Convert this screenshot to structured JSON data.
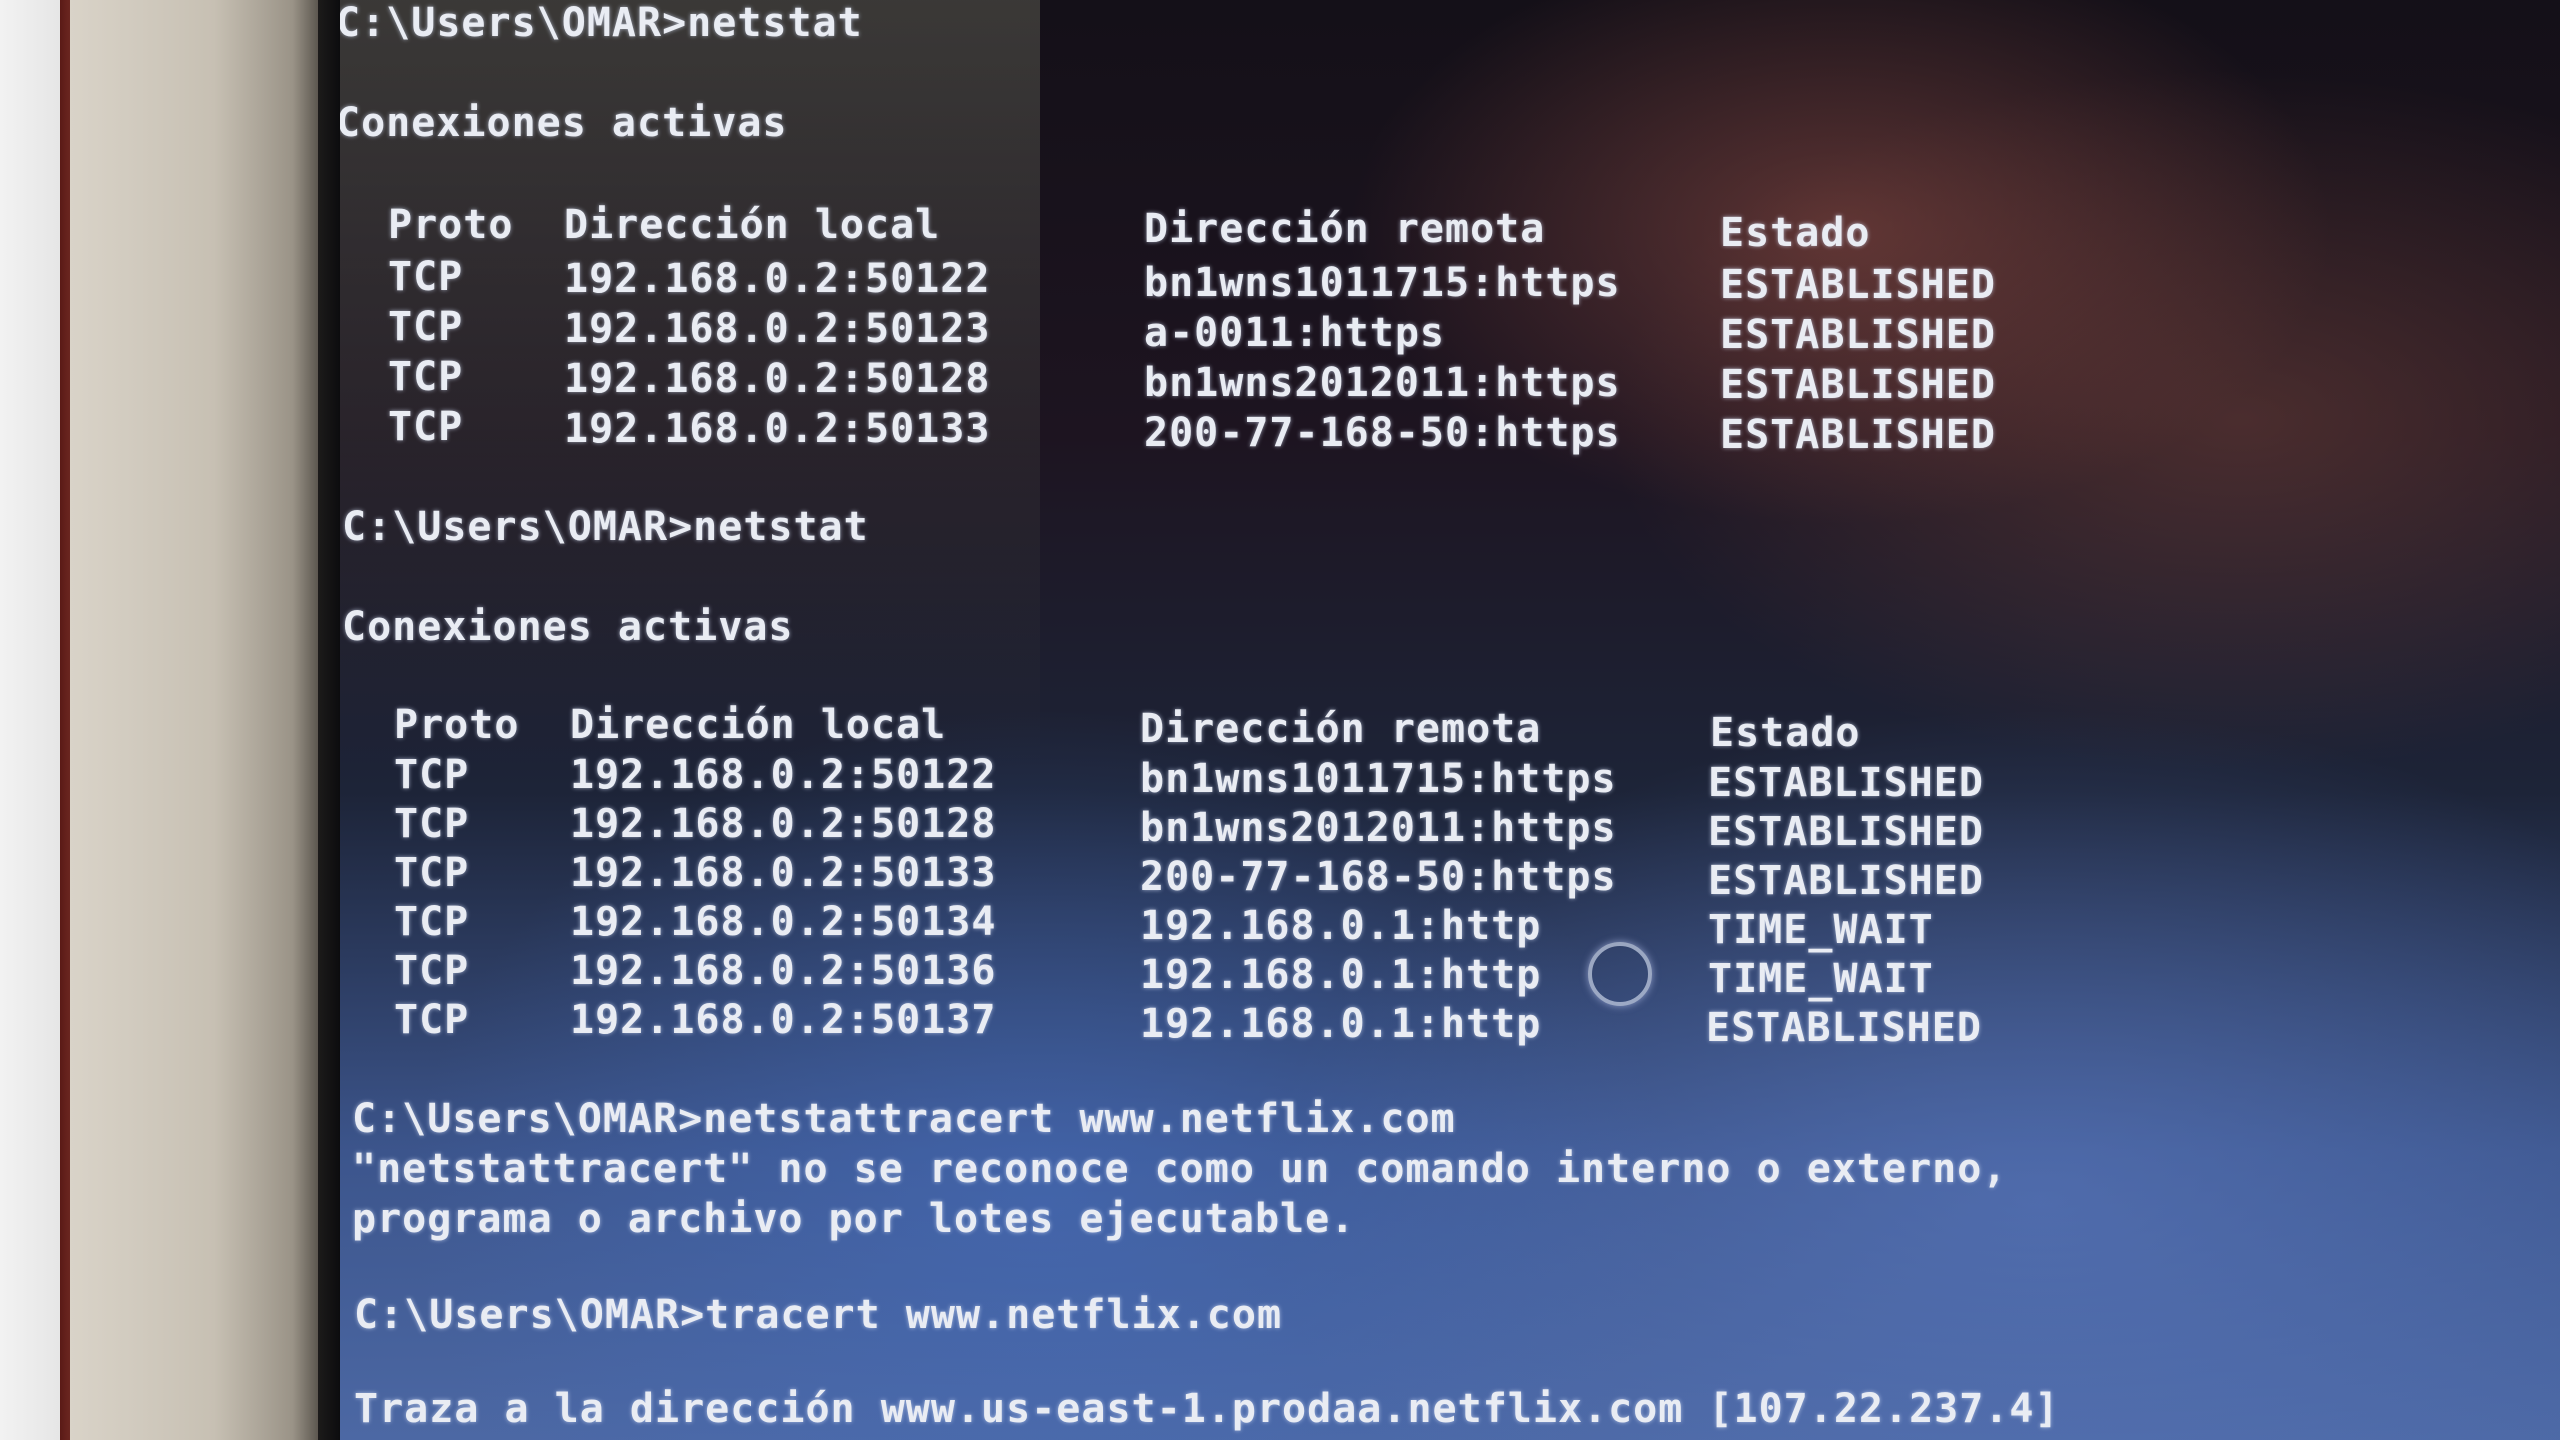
{
  "session1": {
    "prompt": "C:\\Users\\OMAR>netstat",
    "heading": "Conexiones activas",
    "columns": [
      "Proto",
      "Dirección local",
      "Dirección remota",
      "Estado"
    ],
    "rows": [
      [
        "TCP",
        "192.168.0.2:50122",
        "bn1wns1011715:https",
        "ESTABLISHED"
      ],
      [
        "TCP",
        "192.168.0.2:50123",
        "a-0011:https",
        "ESTABLISHED"
      ],
      [
        "TCP",
        "192.168.0.2:50128",
        "bn1wns2012011:https",
        "ESTABLISHED"
      ],
      [
        "TCP",
        "192.168.0.2:50133",
        "200-77-168-50:https",
        "ESTABLISHED"
      ]
    ]
  },
  "session2": {
    "prompt": "C:\\Users\\OMAR>netstat",
    "heading": "Conexiones activas",
    "columns": [
      "Proto",
      "Dirección local",
      "Dirección remota",
      "Estado"
    ],
    "rows": [
      [
        "TCP",
        "192.168.0.2:50122",
        "bn1wns1011715:https",
        "ESTABLISHED"
      ],
      [
        "TCP",
        "192.168.0.2:50128",
        "bn1wns2012011:https",
        "ESTABLISHED"
      ],
      [
        "TCP",
        "192.168.0.2:50133",
        "200-77-168-50:https",
        "ESTABLISHED"
      ],
      [
        "TCP",
        "192.168.0.2:50134",
        "192.168.0.1:http",
        "TIME_WAIT"
      ],
      [
        "TCP",
        "192.168.0.2:50136",
        "192.168.0.1:http",
        "TIME_WAIT"
      ],
      [
        "TCP",
        "192.168.0.2:50137",
        "192.168.0.1:http",
        "ESTABLISHED"
      ]
    ]
  },
  "session3": {
    "prompt": "C:\\Users\\OMAR>netstattracert www.netflix.com",
    "error_line1": "\"netstattracert\" no se reconoce como un comando interno o externo,",
    "error_line2": "programa o archivo por lotes ejecutable."
  },
  "session4": {
    "prompt": "C:\\Users\\OMAR>tracert www.netflix.com",
    "output": "Traza a la dirección www.us-east-1.prodaa.netflix.com [107.22.237.4]"
  }
}
